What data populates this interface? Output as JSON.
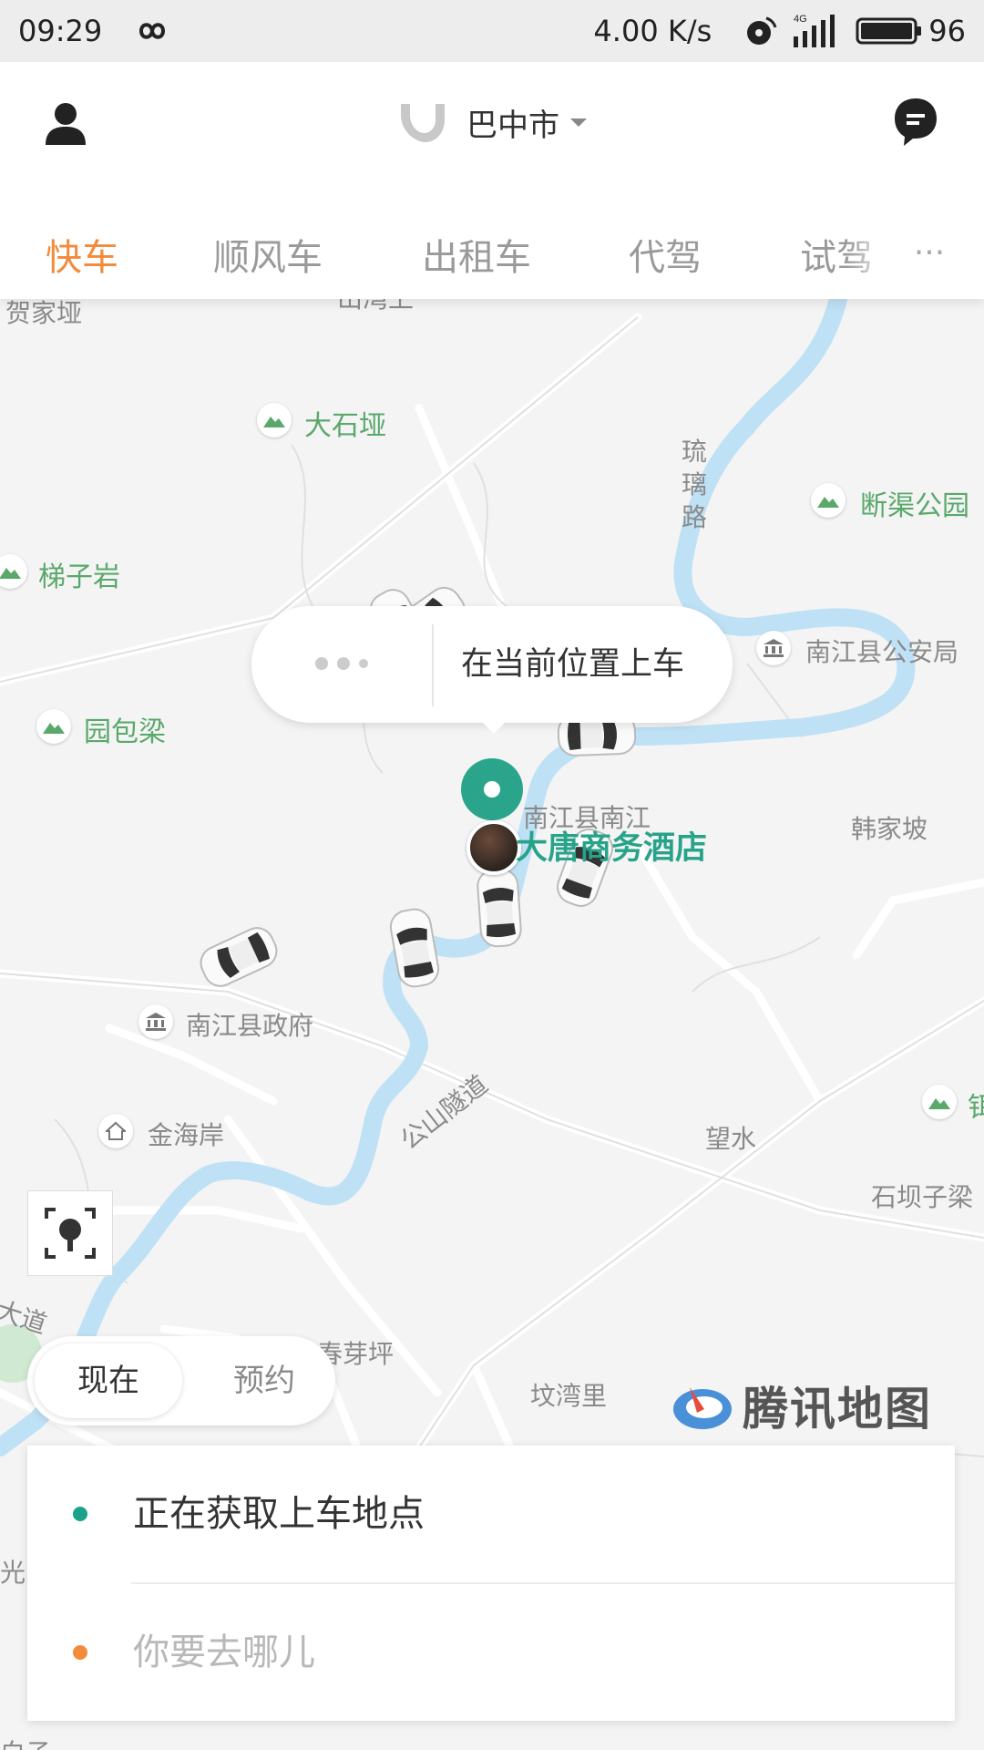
{
  "status_bar": {
    "time": "09:29",
    "net_speed": "4.00 K/s",
    "network_type": "4G",
    "battery": "96",
    "icons": [
      "infinity-icon",
      "hotspot-icon",
      "signal-icon",
      "battery-icon"
    ]
  },
  "header": {
    "city": "巴中市",
    "tabs": [
      "快车",
      "顺风车",
      "出租车",
      "代驾",
      "试驾"
    ],
    "active_tab": "快车",
    "more": "···"
  },
  "map": {
    "labels": {
      "jiajiaba": "贺家垭",
      "top_cut": "山湾上",
      "dashiya": "大石垭",
      "liuli_road": "琉璃路",
      "duanqu_park": "断渠公园",
      "tizi_yan": "梯子岩",
      "police": "南江县公安局",
      "yuanbaoliang": "园包梁",
      "nanjiang_nanjiang": "南江县南江",
      "hanjiapo": "韩家坡",
      "county_gov": "南江县政府",
      "right_edge": "铒",
      "gongshan_tunnel": "公山隧道",
      "jinhaian": "金海岸",
      "wangshui": "望水",
      "shibazi": "石坝子梁",
      "dadao": "大道",
      "chunyaping": "春芽坪",
      "wenwanli": "坟湾里",
      "left_bottom": "光",
      "bottom_cut": "白子"
    },
    "bubble_text": "在当前位置上车",
    "hotel_name": "大唐商务酒店",
    "brand": "腾讯地图",
    "accent_green": "#2aa58b",
    "river_color": "#bfe1f5"
  },
  "time_toggle": {
    "now": "现在",
    "later": "预约"
  },
  "card": {
    "pickup": "正在获取上车地点",
    "destination_placeholder": "你要去哪儿",
    "pickup_dot_color": "#1aa387",
    "dest_dot_color": "#f28b3c"
  }
}
